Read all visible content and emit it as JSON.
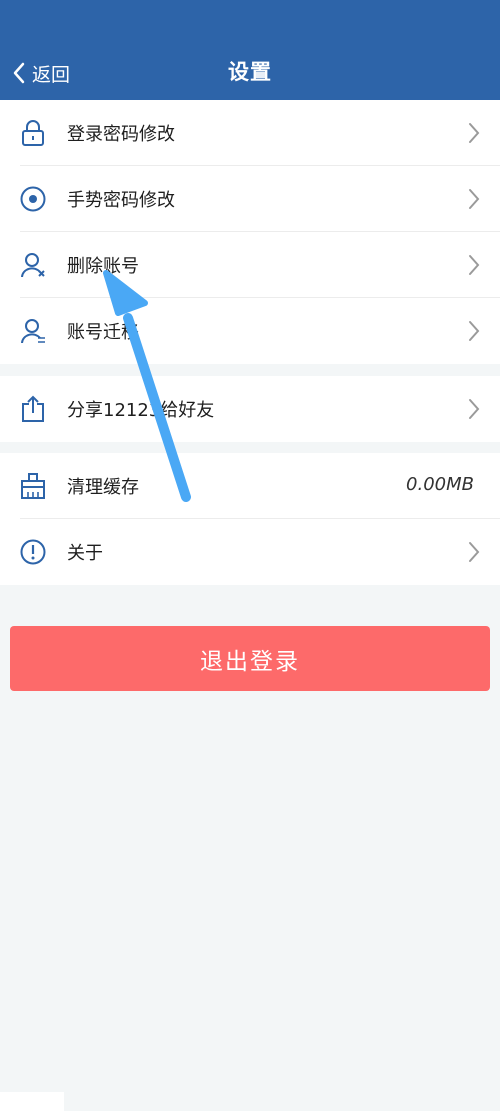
{
  "header": {
    "back_label": "返回",
    "title": "设置",
    "background": "#2d64a9"
  },
  "settings": {
    "group1": [
      {
        "label": "登录密码修改",
        "icon": "lock-icon"
      },
      {
        "label": "手势密码修改",
        "icon": "gesture-icon"
      },
      {
        "label": "删除账号",
        "icon": "user-delete-icon"
      },
      {
        "label": "账号迁移",
        "icon": "user-migrate-icon"
      }
    ],
    "group2": [
      {
        "label": "分享12123给好友",
        "icon": "share-icon"
      }
    ],
    "group3": [
      {
        "label": "清理缓存",
        "icon": "broom-icon",
        "value": "0.00MB"
      },
      {
        "label": "关于",
        "icon": "info-icon"
      }
    ]
  },
  "logout_label": "退出登录",
  "colors": {
    "logout": "#fd6a6a",
    "icon": "#2d64a9",
    "arrow": "#4aa8f5"
  }
}
